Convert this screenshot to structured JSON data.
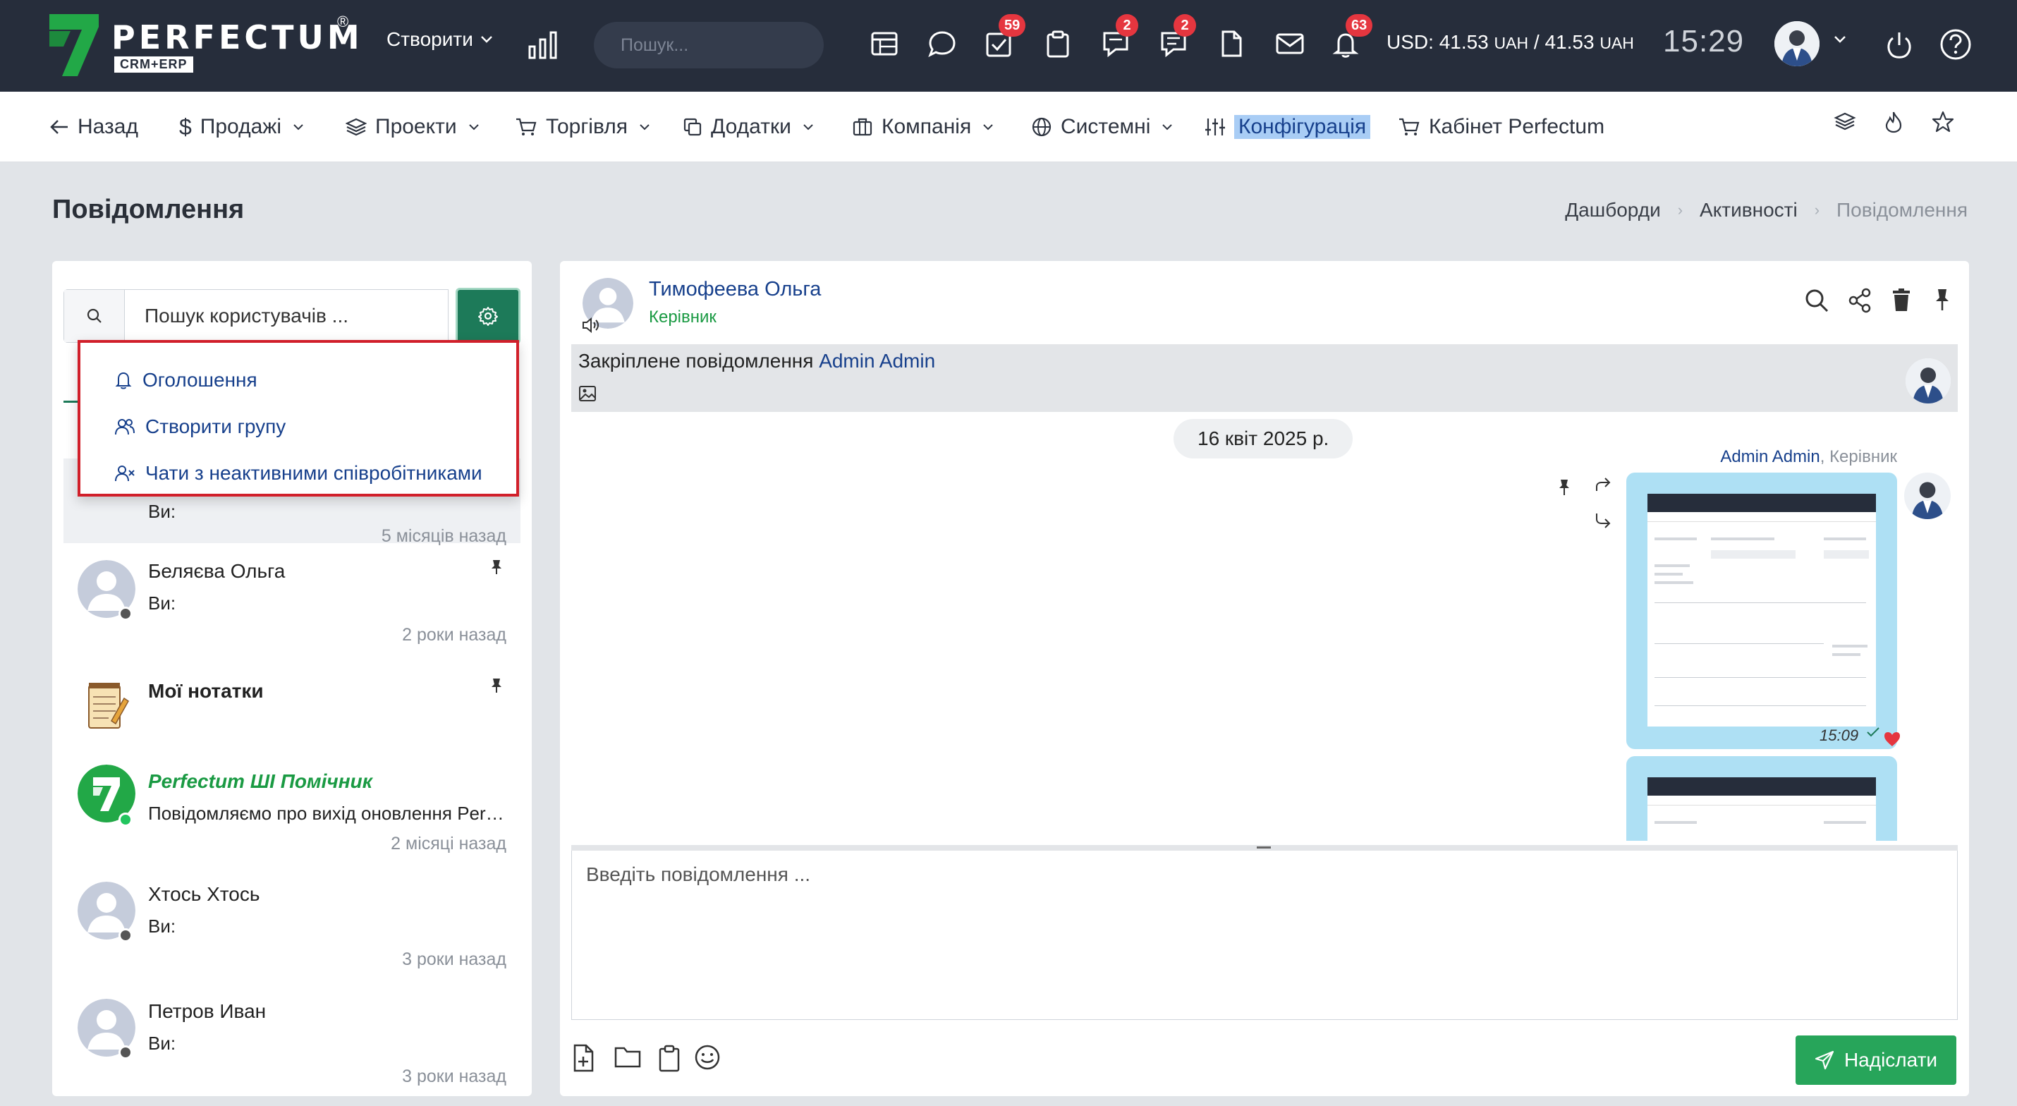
{
  "brand": {
    "name": "PERFECTUM",
    "reg": "®",
    "sub": "CRM+ERP"
  },
  "topbar": {
    "create_label": "Створити",
    "search_placeholder": "Пошук...",
    "badges": {
      "tasks": "59",
      "chat": "2",
      "comments": "2",
      "notifications": "63"
    },
    "currency": {
      "usd_label": "USD:",
      "rate1": "41.53",
      "unit1": "UAH",
      "slash": "/",
      "rate2": "41.53",
      "unit2": "UAH"
    },
    "time": "15:29"
  },
  "nav": {
    "back": "Назад",
    "sales": "Продажі",
    "projects": "Проекти",
    "trade": "Торгівля",
    "addons": "Додатки",
    "company": "Компанія",
    "system": "Системні",
    "config": "Конфігурація",
    "cabinet": "Кабінет Perfectum"
  },
  "page": {
    "title": "Повідомлення",
    "breadcrumb": [
      "Дашборди",
      "Активності",
      "Повідомлення"
    ]
  },
  "left": {
    "search_placeholder": "Пошук користувачів ...",
    "dropdown": [
      "Оголошення",
      "Створити групу",
      "Чати з неактивними співробітниками"
    ],
    "first_item": {
      "preview": "Ви:",
      "time": "5 місяців назад"
    },
    "chats": [
      {
        "name": "Беляєва Ольга",
        "preview": "Ви:",
        "time": "2 роки назад"
      },
      {
        "name": "Мої нотатки",
        "preview": "",
        "time": ""
      },
      {
        "name": "Perfectum ШІ Помічник",
        "preview": "Повідомляємо про вихід оновлення Perfectum CRM+ERP",
        "time": "2 місяці назад"
      },
      {
        "name": "Хтось Хтось",
        "preview": "Ви:",
        "time": "3 роки назад"
      },
      {
        "name": "Петров Иван",
        "preview": "Ви:",
        "time": "3 роки назад"
      }
    ]
  },
  "chat": {
    "contact_name": "Тимофеева Ольга",
    "contact_role": "Керівник",
    "pinned_label": "Закріплене повідомлення",
    "pinned_author": "Admin Admin",
    "date": "16 квіт 2025 р.",
    "msg_author": "Admin Admin",
    "msg_role": ", Керівник",
    "msg_time": "15:09",
    "composer_placeholder": "Введіть повідомлення ...",
    "send_label": "Надіслати"
  },
  "colors": {
    "topbar": "#262d3b",
    "accent_green": "#1d7a59",
    "send_green": "#27a55a",
    "link_blue": "#17408c",
    "badge_red": "#e5363f",
    "highlight": "#d11f2a"
  }
}
